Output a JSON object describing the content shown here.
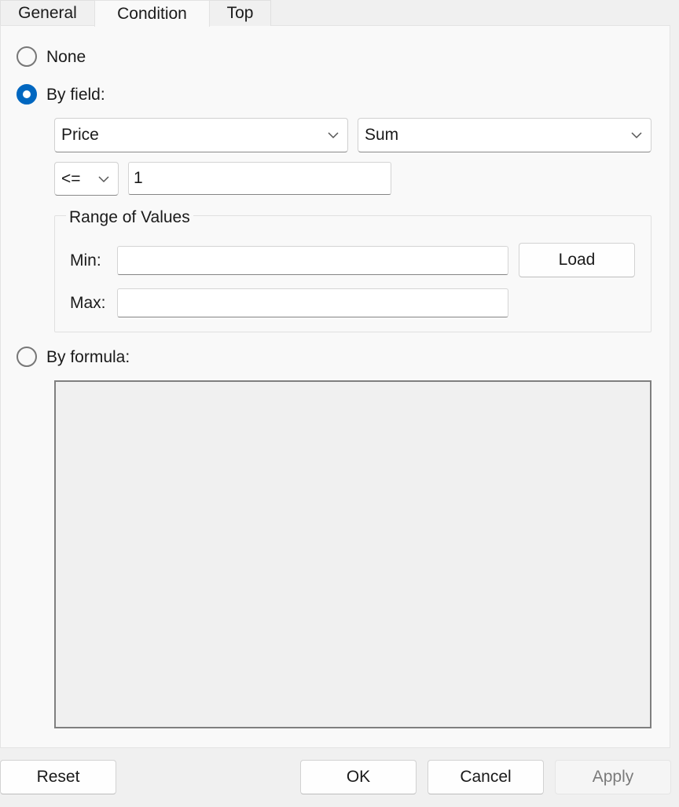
{
  "tabs": [
    {
      "label": "General"
    },
    {
      "label": "Condition"
    },
    {
      "label": "Top"
    }
  ],
  "active_tab": "Condition",
  "radios": {
    "none": {
      "label": "None",
      "checked": false
    },
    "by_field": {
      "label": "By field:",
      "checked": true
    },
    "by_formula": {
      "label": "By formula:",
      "checked": false
    }
  },
  "by_field": {
    "field_combo": {
      "value": "Price"
    },
    "aggregate_combo": {
      "value": "Sum"
    },
    "operator_combo": {
      "value": "<="
    },
    "value_input": {
      "value": "1"
    }
  },
  "range": {
    "title": "Range of Values",
    "min_label": "Min:",
    "min_value": "",
    "max_label": "Max:",
    "max_value": "",
    "load_label": "Load"
  },
  "formula": {
    "value": ""
  },
  "buttons": {
    "reset": "Reset",
    "ok": "OK",
    "cancel": "Cancel",
    "apply": "Apply"
  },
  "colors": {
    "accent": "#0067c0"
  }
}
